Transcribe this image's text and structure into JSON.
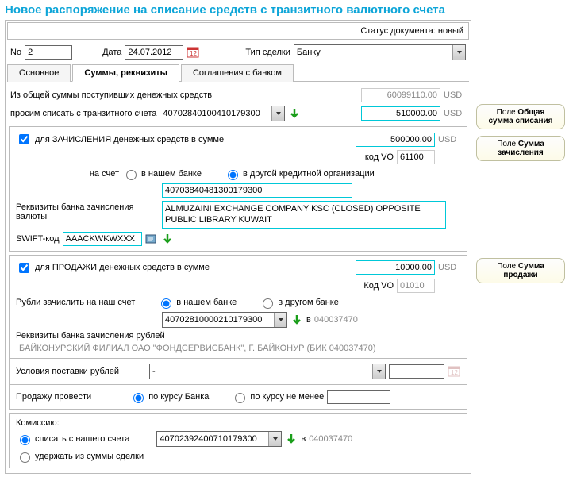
{
  "title": "Новое распоряжение на списание средств с транзитного валютного счета",
  "status": {
    "label": "Статус документа:",
    "value": "новый"
  },
  "header": {
    "no_label": "No",
    "no_value": "2",
    "date_label": "Дата",
    "date_value": "24.07.2012",
    "deal_label": "Тип сделки",
    "deal_value": "Банку"
  },
  "tabs": {
    "t1": "Основное",
    "t2": "Суммы, реквизиты",
    "t3": "Соглашения с банком"
  },
  "sums": {
    "total_label": "Из общей суммы поступивших денежных средств",
    "total_value": "60099110.00",
    "currency": "USD",
    "transit_label": "просим списать с транзитного счета",
    "transit_account": "40702840100410179300",
    "transit_value": "510000.00"
  },
  "credit": {
    "check_label": "для ЗАЧИСЛЕНИЯ денежных средств в сумме",
    "sum": "500000.00",
    "currency": "USD",
    "vo_label": "код VO",
    "vo_value": "61100",
    "account_label": "на счет",
    "opt_our": "в нашем банке",
    "opt_other": "в другой кредитной организации",
    "account": "40703840481300179300",
    "bank_label": "Реквизиты банка зачисления валюты",
    "bank_details": "ALMUZAINI EXCHANGE COMPANY KSC (CLOSED) OPPOSITE PUBLIC LIBRARY KUWAIT",
    "swift_label": "SWIFT-код",
    "swift_value": "AAACKWKWXXX"
  },
  "sale": {
    "check_label": "для ПРОДАЖИ денежных средств в сумме",
    "sum": "10000.00",
    "currency": "USD",
    "vo_label": "Код VO",
    "vo_value": "01010",
    "rub_label": "Рубли зачислить на наш счет",
    "opt_our": "в нашем банке",
    "opt_other": "в другом банке",
    "account": "40702810000210179300",
    "in_label": "в",
    "bik": "040037470",
    "bank_label": "Реквизиты банка зачисления рублей",
    "bank_details": "БАЙКОНУРСКИЙ ФИЛИАЛ ОАО \"ФОНДСЕРВИСБАНК\", Г. БАЙКОНУР (БИК 040037470)",
    "terms_label": "Условия поставки рублей",
    "terms_value": "-",
    "exec_label": "Продажу провести",
    "opt_rate_bank": "по курсу Банка",
    "opt_rate_min": "по курсу не менее"
  },
  "commission": {
    "label": "Комиссию:",
    "opt_write": "списать с нашего счета",
    "opt_hold": "удержать из суммы сделки",
    "account": "40702392400710179300",
    "in_label": "в",
    "bik": "040037470"
  },
  "callouts": {
    "c1a": "Поле ",
    "c1b": "Общая сумма списания",
    "c2a": "Поле ",
    "c2b": "Сумма зачисления",
    "c3a": "Поле ",
    "c3b": "Сумма продажи"
  }
}
